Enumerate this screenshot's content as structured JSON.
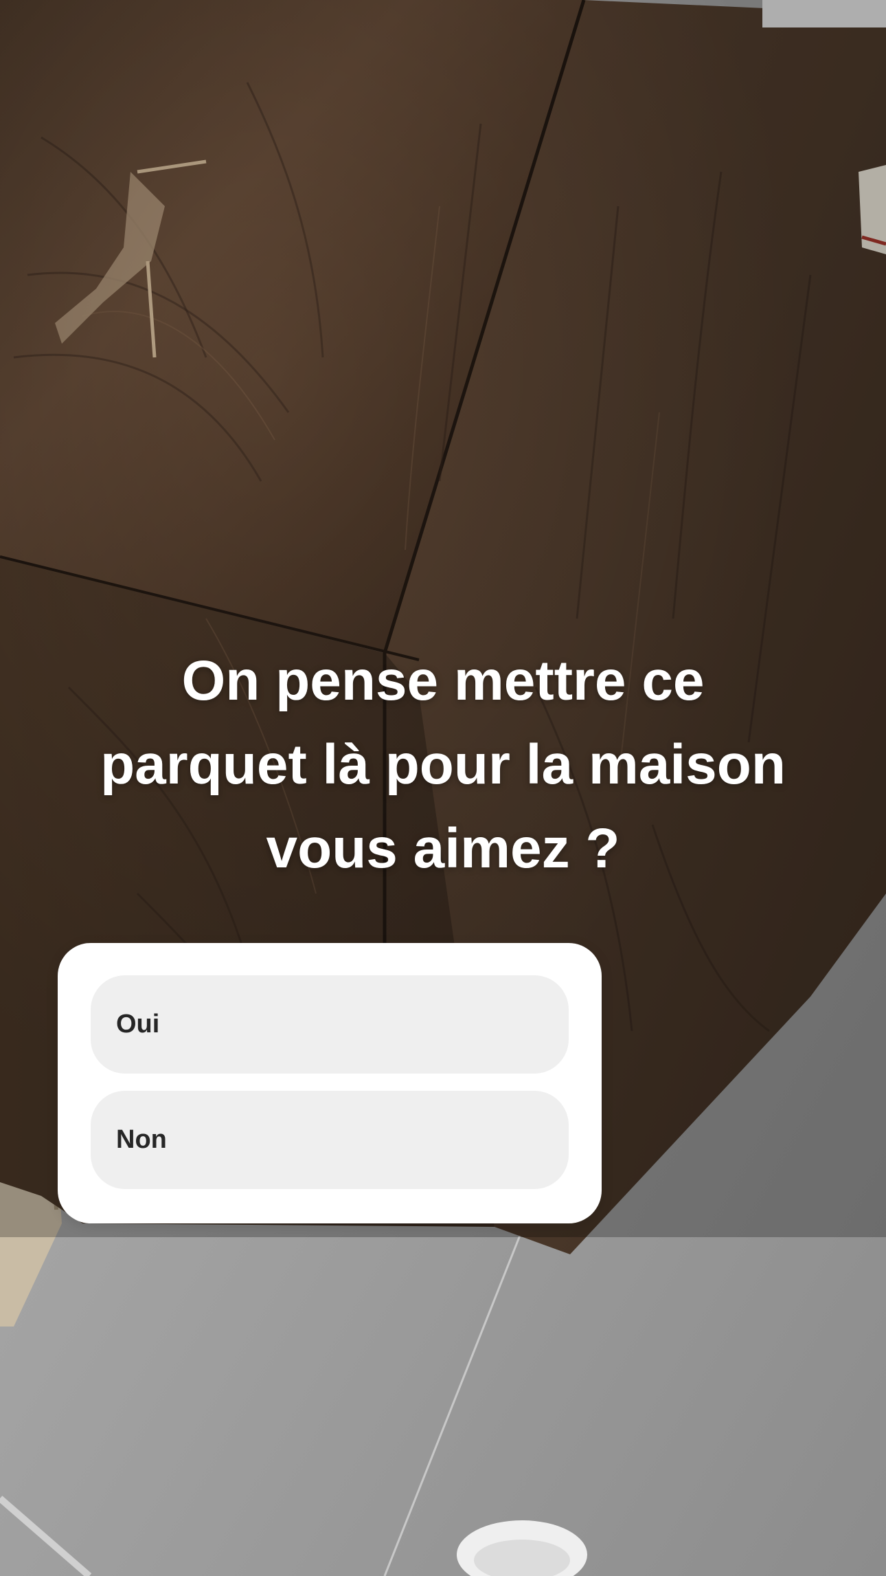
{
  "story": {
    "caption_lines": [
      "On pense mettre ce",
      "parquet là pour la maison",
      "vous aimez ?"
    ]
  },
  "poll": {
    "options": [
      {
        "label": "Oui"
      },
      {
        "label": "Non"
      }
    ]
  },
  "colors": {
    "caption_text": "#ffffff",
    "poll_card": "#ffffff",
    "poll_option_bg": "#efefef",
    "poll_option_text": "#262626",
    "wood_dark": "#3b2c22",
    "wood_mid": "#5a4333",
    "floor": "#9a9a9a"
  }
}
